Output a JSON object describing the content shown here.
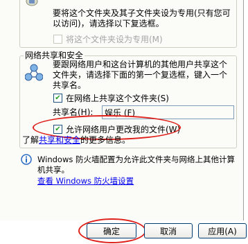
{
  "private": {
    "description_line1": "要将这个文件夹及其子文件夹设为专用(只有您可",
    "description_line2": "以访问)，请选择以下复选框。",
    "make_private_label": "将这个文件夹设为专用(M)"
  },
  "sharing": {
    "legend": "网络共享和安全",
    "description_line1": "要跟网络用户和这台计算机的其他用户共享这个",
    "description_line2": "文件夹，请选择下面的第一个复选框，键入一个",
    "description_line3": "共享名。",
    "share_label": "在网络上共享这个文件夹(S)",
    "share_name_label": "共享名(H):",
    "share_name_value": "娱乐 (F)",
    "allow_change_label": "允许网络用户更改我的文件(W)",
    "learn_more_prefix": "了解",
    "learn_more_link": "共享和安全",
    "learn_more_suffix": "的更多信息。"
  },
  "firewall": {
    "line1": "Windows 防火墙配置为允许此文件夹与网络上其他计算",
    "line2": "机共享。",
    "link": "查看 Windows 防火墙设置"
  },
  "buttons": {
    "ok": "确定",
    "cancel": "取消",
    "apply": "应用(A)"
  },
  "check_mark": "✔"
}
